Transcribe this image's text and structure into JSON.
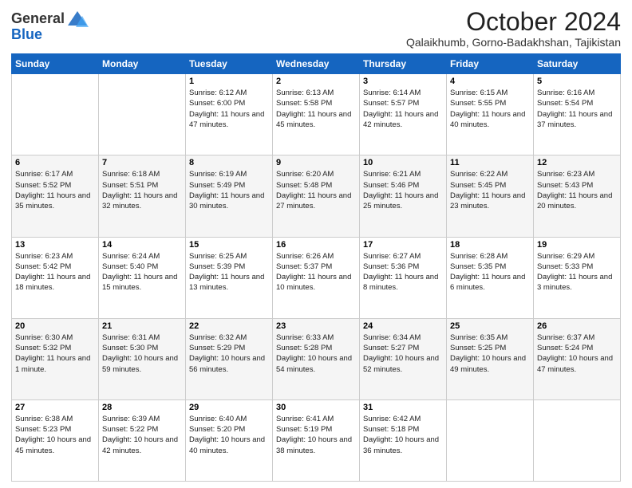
{
  "header": {
    "logo_general": "General",
    "logo_blue": "Blue",
    "month_title": "October 2024",
    "location": "Qalaikhumb, Gorno-Badakhshan, Tajikistan"
  },
  "days_of_week": [
    "Sunday",
    "Monday",
    "Tuesday",
    "Wednesday",
    "Thursday",
    "Friday",
    "Saturday"
  ],
  "weeks": [
    [
      {
        "day": "",
        "sunrise": "",
        "sunset": "",
        "daylight": ""
      },
      {
        "day": "",
        "sunrise": "",
        "sunset": "",
        "daylight": ""
      },
      {
        "day": "1",
        "sunrise": "Sunrise: 6:12 AM",
        "sunset": "Sunset: 6:00 PM",
        "daylight": "Daylight: 11 hours and 47 minutes."
      },
      {
        "day": "2",
        "sunrise": "Sunrise: 6:13 AM",
        "sunset": "Sunset: 5:58 PM",
        "daylight": "Daylight: 11 hours and 45 minutes."
      },
      {
        "day": "3",
        "sunrise": "Sunrise: 6:14 AM",
        "sunset": "Sunset: 5:57 PM",
        "daylight": "Daylight: 11 hours and 42 minutes."
      },
      {
        "day": "4",
        "sunrise": "Sunrise: 6:15 AM",
        "sunset": "Sunset: 5:55 PM",
        "daylight": "Daylight: 11 hours and 40 minutes."
      },
      {
        "day": "5",
        "sunrise": "Sunrise: 6:16 AM",
        "sunset": "Sunset: 5:54 PM",
        "daylight": "Daylight: 11 hours and 37 minutes."
      }
    ],
    [
      {
        "day": "6",
        "sunrise": "Sunrise: 6:17 AM",
        "sunset": "Sunset: 5:52 PM",
        "daylight": "Daylight: 11 hours and 35 minutes."
      },
      {
        "day": "7",
        "sunrise": "Sunrise: 6:18 AM",
        "sunset": "Sunset: 5:51 PM",
        "daylight": "Daylight: 11 hours and 32 minutes."
      },
      {
        "day": "8",
        "sunrise": "Sunrise: 6:19 AM",
        "sunset": "Sunset: 5:49 PM",
        "daylight": "Daylight: 11 hours and 30 minutes."
      },
      {
        "day": "9",
        "sunrise": "Sunrise: 6:20 AM",
        "sunset": "Sunset: 5:48 PM",
        "daylight": "Daylight: 11 hours and 27 minutes."
      },
      {
        "day": "10",
        "sunrise": "Sunrise: 6:21 AM",
        "sunset": "Sunset: 5:46 PM",
        "daylight": "Daylight: 11 hours and 25 minutes."
      },
      {
        "day": "11",
        "sunrise": "Sunrise: 6:22 AM",
        "sunset": "Sunset: 5:45 PM",
        "daylight": "Daylight: 11 hours and 23 minutes."
      },
      {
        "day": "12",
        "sunrise": "Sunrise: 6:23 AM",
        "sunset": "Sunset: 5:43 PM",
        "daylight": "Daylight: 11 hours and 20 minutes."
      }
    ],
    [
      {
        "day": "13",
        "sunrise": "Sunrise: 6:23 AM",
        "sunset": "Sunset: 5:42 PM",
        "daylight": "Daylight: 11 hours and 18 minutes."
      },
      {
        "day": "14",
        "sunrise": "Sunrise: 6:24 AM",
        "sunset": "Sunset: 5:40 PM",
        "daylight": "Daylight: 11 hours and 15 minutes."
      },
      {
        "day": "15",
        "sunrise": "Sunrise: 6:25 AM",
        "sunset": "Sunset: 5:39 PM",
        "daylight": "Daylight: 11 hours and 13 minutes."
      },
      {
        "day": "16",
        "sunrise": "Sunrise: 6:26 AM",
        "sunset": "Sunset: 5:37 PM",
        "daylight": "Daylight: 11 hours and 10 minutes."
      },
      {
        "day": "17",
        "sunrise": "Sunrise: 6:27 AM",
        "sunset": "Sunset: 5:36 PM",
        "daylight": "Daylight: 11 hours and 8 minutes."
      },
      {
        "day": "18",
        "sunrise": "Sunrise: 6:28 AM",
        "sunset": "Sunset: 5:35 PM",
        "daylight": "Daylight: 11 hours and 6 minutes."
      },
      {
        "day": "19",
        "sunrise": "Sunrise: 6:29 AM",
        "sunset": "Sunset: 5:33 PM",
        "daylight": "Daylight: 11 hours and 3 minutes."
      }
    ],
    [
      {
        "day": "20",
        "sunrise": "Sunrise: 6:30 AM",
        "sunset": "Sunset: 5:32 PM",
        "daylight": "Daylight: 11 hours and 1 minute."
      },
      {
        "day": "21",
        "sunrise": "Sunrise: 6:31 AM",
        "sunset": "Sunset: 5:30 PM",
        "daylight": "Daylight: 10 hours and 59 minutes."
      },
      {
        "day": "22",
        "sunrise": "Sunrise: 6:32 AM",
        "sunset": "Sunset: 5:29 PM",
        "daylight": "Daylight: 10 hours and 56 minutes."
      },
      {
        "day": "23",
        "sunrise": "Sunrise: 6:33 AM",
        "sunset": "Sunset: 5:28 PM",
        "daylight": "Daylight: 10 hours and 54 minutes."
      },
      {
        "day": "24",
        "sunrise": "Sunrise: 6:34 AM",
        "sunset": "Sunset: 5:27 PM",
        "daylight": "Daylight: 10 hours and 52 minutes."
      },
      {
        "day": "25",
        "sunrise": "Sunrise: 6:35 AM",
        "sunset": "Sunset: 5:25 PM",
        "daylight": "Daylight: 10 hours and 49 minutes."
      },
      {
        "day": "26",
        "sunrise": "Sunrise: 6:37 AM",
        "sunset": "Sunset: 5:24 PM",
        "daylight": "Daylight: 10 hours and 47 minutes."
      }
    ],
    [
      {
        "day": "27",
        "sunrise": "Sunrise: 6:38 AM",
        "sunset": "Sunset: 5:23 PM",
        "daylight": "Daylight: 10 hours and 45 minutes."
      },
      {
        "day": "28",
        "sunrise": "Sunrise: 6:39 AM",
        "sunset": "Sunset: 5:22 PM",
        "daylight": "Daylight: 10 hours and 42 minutes."
      },
      {
        "day": "29",
        "sunrise": "Sunrise: 6:40 AM",
        "sunset": "Sunset: 5:20 PM",
        "daylight": "Daylight: 10 hours and 40 minutes."
      },
      {
        "day": "30",
        "sunrise": "Sunrise: 6:41 AM",
        "sunset": "Sunset: 5:19 PM",
        "daylight": "Daylight: 10 hours and 38 minutes."
      },
      {
        "day": "31",
        "sunrise": "Sunrise: 6:42 AM",
        "sunset": "Sunset: 5:18 PM",
        "daylight": "Daylight: 10 hours and 36 minutes."
      },
      {
        "day": "",
        "sunrise": "",
        "sunset": "",
        "daylight": ""
      },
      {
        "day": "",
        "sunrise": "",
        "sunset": "",
        "daylight": ""
      }
    ]
  ]
}
